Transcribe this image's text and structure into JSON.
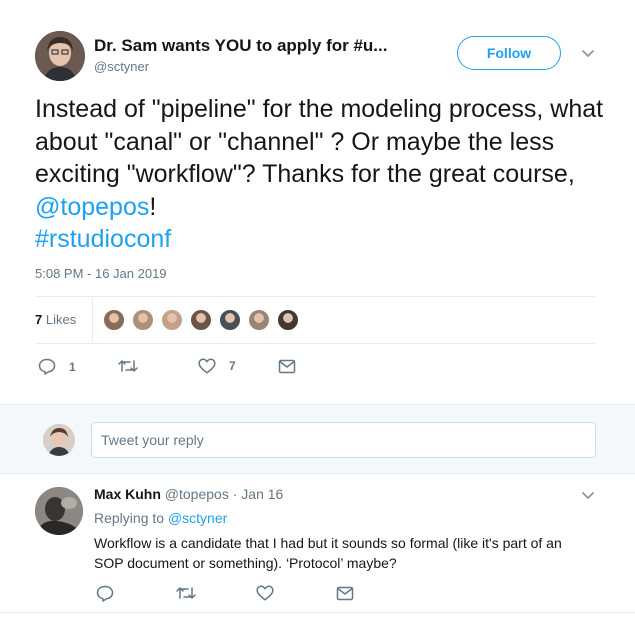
{
  "tweet": {
    "author_name": "Dr. Sam wants YOU to apply for #u...",
    "author_handle": "@sctyner",
    "follow_label": "Follow",
    "text_plain": "Instead of \"pipeline\" for the modeling process, what about \"canal\" or \"channel\" ? Or maybe the less exciting \"workflow\"? Thanks for the great course, ",
    "mention": "@topepos",
    "text_end": "!",
    "hashtag": "#rstudioconf",
    "timestamp": "5:08 PM - 16 Jan 2019",
    "likes_count": "7",
    "likes_word": "Likes",
    "actions": {
      "reply_count": "1",
      "retweet_count": "",
      "like_count": "7"
    },
    "icons": {
      "more": "chevron-down-icon",
      "reply": "reply-icon",
      "retweet": "retweet-icon",
      "like": "heart-icon",
      "dm": "envelope-icon"
    },
    "liker_colors": [
      "#8a6b5a",
      "#b08f7a",
      "#c4a08a",
      "#6b5549",
      "#4a4e55",
      "#9c8570",
      "#3f3a36"
    ]
  },
  "reply_box": {
    "placeholder": "Tweet your reply"
  },
  "reply": {
    "name": "Max Kuhn",
    "handle": "@topepos",
    "dot": "·",
    "date": "Jan 16",
    "replying_prefix": "Replying to",
    "replying_to": "@sctyner",
    "text": "Workflow is a candidate that I had but it sounds so formal (like it's part of an SOP document or something).  ‘Protocol’ maybe?"
  },
  "colors": {
    "accent": "#1da1f2",
    "muted": "#657786",
    "text": "#14171a",
    "divider": "#e6ecf0"
  }
}
